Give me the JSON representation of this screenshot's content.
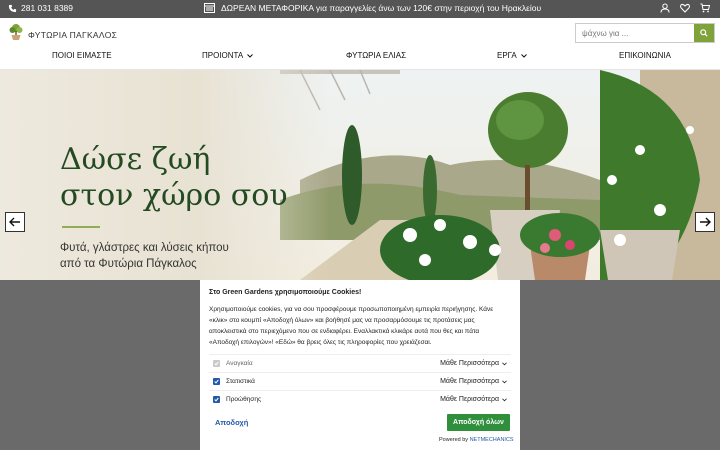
{
  "topbar": {
    "phone": "281 031 8389",
    "promo": "ΔΩΡΕΑΝ ΜΕΤΑΦΟΡΙΚΑ για παραγγελίες άνω των 120€ στην περιοχή του Ηρακλείου",
    "icons": [
      "user-icon",
      "heart-icon",
      "cart-icon"
    ]
  },
  "header": {
    "logo_text": "ΦΥΤΩΡΙΑ ΠΑΓΚΑΛΟΣ",
    "search_placeholder": "ψάχνω για ..."
  },
  "nav": {
    "items": [
      {
        "label": "ΠΟΙΟΙ ΕΙΜΑΣΤΕ",
        "dropdown": false
      },
      {
        "label": "ΠΡΟΙΟΝΤΑ",
        "dropdown": true
      },
      {
        "label": "ΦΥΤΩΡΙΑ ΕΛΙΑΣ",
        "dropdown": false
      },
      {
        "label": "ΕΡΓΑ",
        "dropdown": true
      },
      {
        "label": "ΕΠΙΚΟΙΝΩΝΙΑ",
        "dropdown": false
      }
    ]
  },
  "hero": {
    "title_line1": "Δώσε ζωή",
    "title_line2": "στον χώρο σου",
    "subtitle_line1": "Φυτά, γλάστρες και λύσεις κήπου",
    "subtitle_line2": "από τα Φυτώρια Πάγκαλος"
  },
  "cookie": {
    "title": "Στο Green Gardens χρησιμοποιούμε Cookies!",
    "text_line1": "Χρησιμοποιούμε cookies, για να σου προσφέρουμε προσωποποιημένη εμπειρία περιήγησης. Κάνε",
    "text_line2": "«κλικ» στο κουμπί «Αποδοχή όλων» και βοήθησέ μας να προσαρμόσουμε τις προτάσεις μας",
    "text_line3": "αποκλειστικά στο περιεχόμενο που σε ενδιαφέρει. Εναλλακτικά κλικάρε αυτά που θες και πάτα",
    "text_line4": "«Αποδοχή επιλογών»! «Εδώ» θα βρεις όλες τις πληροφορίες που χρειάζεσαι.",
    "rows": [
      {
        "label": "Αναγκαία",
        "checked": true,
        "disabled": true,
        "more": "Μάθε Περισσότερα"
      },
      {
        "label": "Στατιστικά",
        "checked": true,
        "disabled": false,
        "more": "Μάθε Περισσότερα"
      },
      {
        "label": "Προώθησης",
        "checked": true,
        "disabled": false,
        "more": "Μάθε Περισσότερα"
      }
    ],
    "reject_label": "Αποδοχή",
    "accept_label": "Αποδοχή όλων",
    "powered_prefix": "Powered by",
    "powered_brand": "NETMECHANICS"
  },
  "colors": {
    "topbar_bg": "#555555",
    "accent_green": "#7fa23a",
    "hero_title": "#244a22",
    "accept_button": "#2f8f3c",
    "link_blue": "#2459a8"
  }
}
